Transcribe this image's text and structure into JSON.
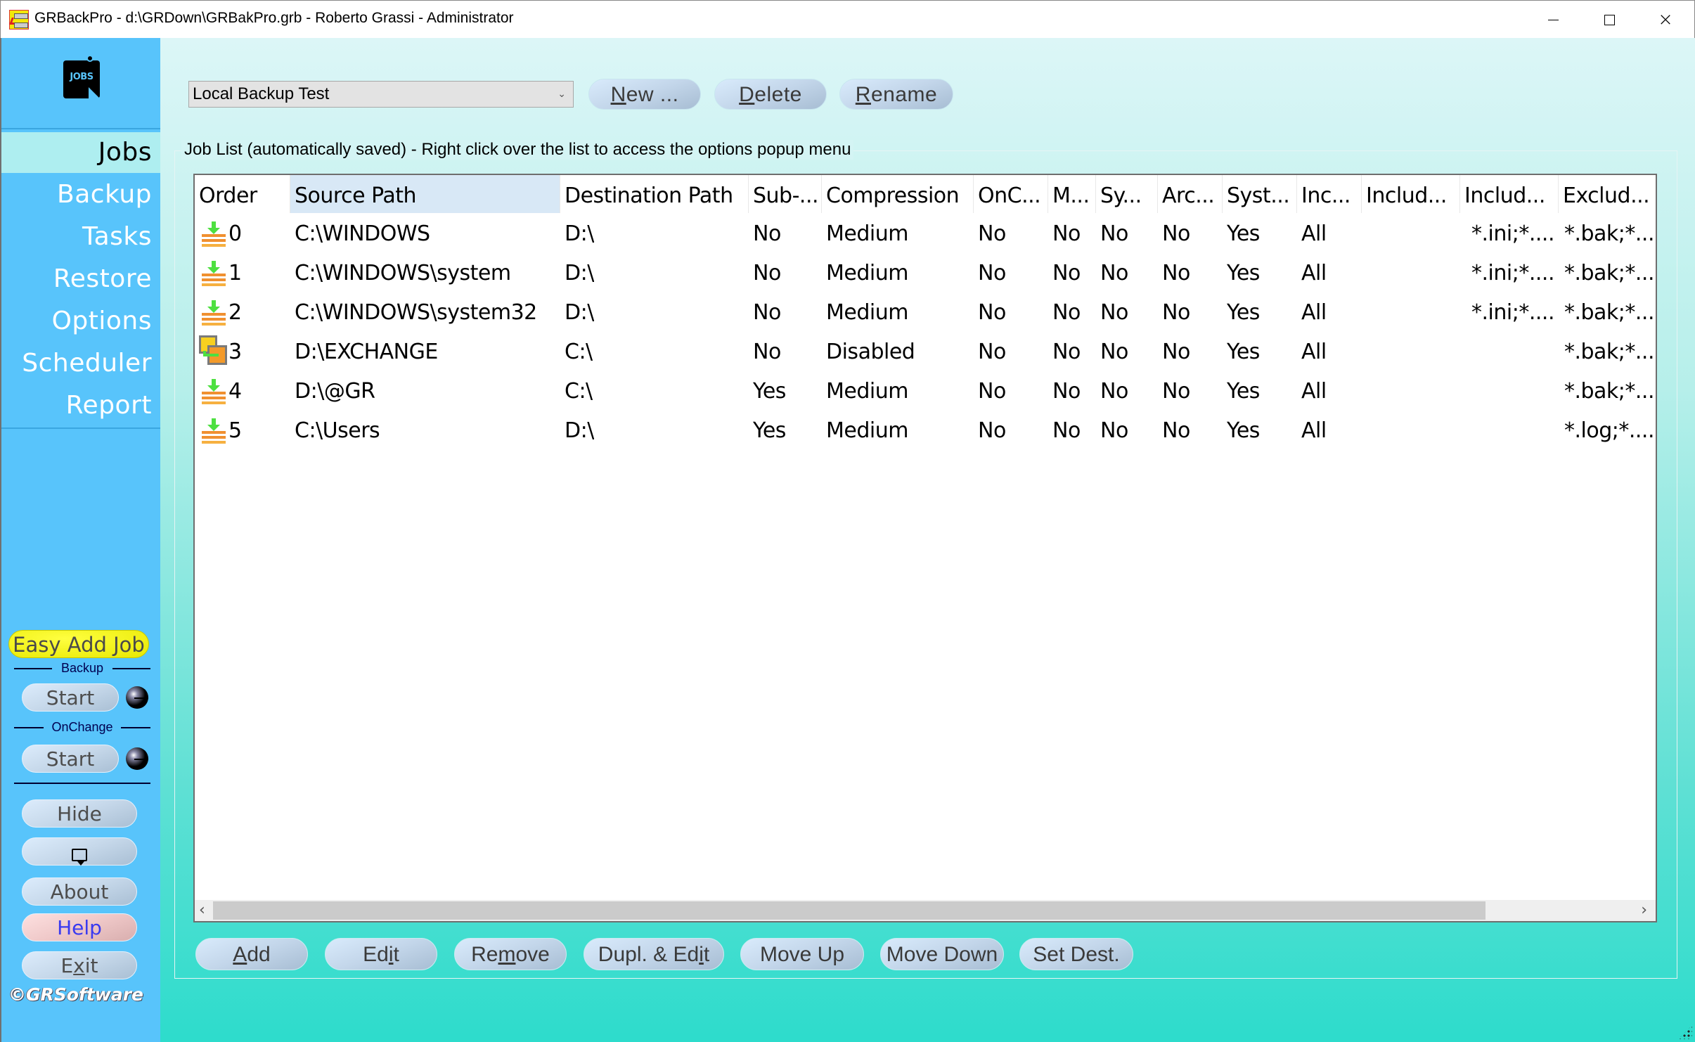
{
  "window": {
    "title": "GRBackPro - d:\\GRDown\\GRBakPro.grb - Roberto Grassi - Administrator",
    "controls": {
      "minimize": "minimize",
      "maximize": "maximize",
      "close": "×"
    }
  },
  "sidebar": {
    "logo_label": "JOBS",
    "nav": [
      {
        "label": "Jobs",
        "active": true
      },
      {
        "label": "Backup"
      },
      {
        "label": "Tasks"
      },
      {
        "label": "Restore"
      },
      {
        "label": "Options"
      },
      {
        "label": "Scheduler"
      },
      {
        "label": "Report"
      }
    ],
    "easy_add_job": "Easy Add Job",
    "backup_section_label": "Backup",
    "backup_start": "Start",
    "onchange_section_label": "OnChange",
    "onchange_start": "Start",
    "hide": "Hide",
    "about": "About",
    "help": "Help",
    "exit_pre": "E",
    "exit_u": "x",
    "exit_post": "it",
    "copyright": "©GRSoftware"
  },
  "toolbar": {
    "job_selected": "Local Backup Test",
    "new_u": "N",
    "new_rest": "ew ...",
    "delete_u": "D",
    "delete_rest": "elete",
    "rename_u": "R",
    "rename_rest": "ename"
  },
  "job_list": {
    "group_label": "Job List (automatically saved) - Right click over the list to access the options popup menu",
    "columns": [
      "Order",
      "Source Path",
      "Destination Path",
      "Sub-...",
      "Compression",
      "OnC...",
      "M...",
      "Sy...",
      "Arc...",
      "Syst...",
      "Inc...",
      "Includ...",
      "Includ...",
      "Exclud..."
    ],
    "sorted_column": "Source Path",
    "rows": [
      {
        "icon": "backup-job-icon",
        "order": "0",
        "source": "C:\\WINDOWS",
        "dest": "D:\\",
        "sub": "No",
        "compression": "Medium",
        "onc": "No",
        "m": "No",
        "sy": "No",
        "arc": "No",
        "syst": "Yes",
        "inc": "All",
        "includ1": "",
        "includ2": "*.ini;*....",
        "exclud": "*.bak;*..."
      },
      {
        "icon": "backup-job-icon",
        "order": "1",
        "source": "C:\\WINDOWS\\system",
        "dest": "D:\\",
        "sub": "No",
        "compression": "Medium",
        "onc": "No",
        "m": "No",
        "sy": "No",
        "arc": "No",
        "syst": "Yes",
        "inc": "All",
        "includ1": "",
        "includ2": "*.ini;*....",
        "exclud": "*.bak;*..."
      },
      {
        "icon": "backup-job-icon",
        "order": "2",
        "source": "C:\\WINDOWS\\system32",
        "dest": "D:\\",
        "sub": "No",
        "compression": "Medium",
        "onc": "No",
        "m": "No",
        "sy": "No",
        "arc": "No",
        "syst": "Yes",
        "inc": "All",
        "includ1": "",
        "includ2": "*.ini;*....",
        "exclud": "*.bak;*..."
      },
      {
        "icon": "sync-job-icon",
        "order": "3",
        "source": "D:\\EXCHANGE",
        "dest": "C:\\",
        "sub": "No",
        "compression": "Disabled",
        "onc": "No",
        "m": "No",
        "sy": "No",
        "arc": "No",
        "syst": "Yes",
        "inc": "All",
        "includ1": "",
        "includ2": "",
        "exclud": "*.bak;*..."
      },
      {
        "icon": "backup-job-icon",
        "order": "4",
        "source": "D:\\@GR",
        "dest": "C:\\",
        "sub": "Yes",
        "compression": "Medium",
        "onc": "No",
        "m": "No",
        "sy": "No",
        "arc": "No",
        "syst": "Yes",
        "inc": "All",
        "includ1": "",
        "includ2": "",
        "exclud": "*.bak;*..."
      },
      {
        "icon": "backup-job-icon",
        "order": "5",
        "source": "C:\\Users",
        "dest": "D:\\",
        "sub": "Yes",
        "compression": "Medium",
        "onc": "No",
        "m": "No",
        "sy": "No",
        "arc": "No",
        "syst": "Yes",
        "inc": "All",
        "includ1": "",
        "includ2": "",
        "exclud": "*.log;*...."
      }
    ]
  },
  "actions": {
    "add_u": "A",
    "add_rest": "dd",
    "edit_pre": "Ed",
    "edit_u": "i",
    "edit_post": "t",
    "remove_pre": "Re",
    "remove_u": "m",
    "remove_post": "ove",
    "dupl_pre": "Dupl. & Ed",
    "dupl_u": "i",
    "dupl_post": "t",
    "move_up": "Move Up",
    "move_down": "Move Down",
    "set_dest": "Set Dest."
  },
  "colors": {
    "sidebar_bg": "#58c4fb",
    "sidebar_active": "#aeeef0",
    "easy_add_bg": "#ffff20",
    "help_text": "#3a3af0",
    "main_top": "#dcf6f7",
    "main_bottom": "#2ddccc"
  }
}
